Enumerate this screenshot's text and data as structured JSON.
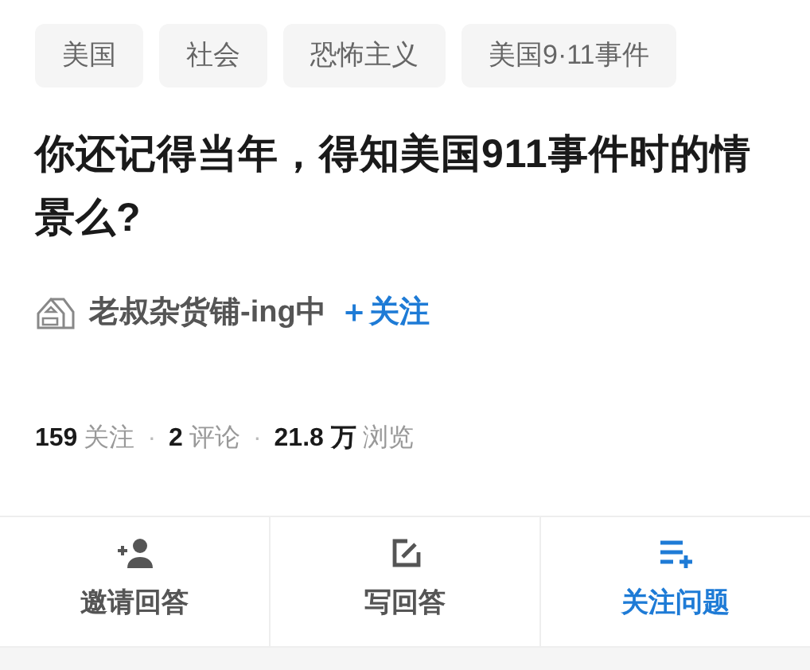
{
  "tags": [
    "美国",
    "社会",
    "恐怖主义",
    "美国9·11事件"
  ],
  "title": "你还记得当年，得知美国911事件时的情景么?",
  "author": {
    "name": "老叔杂货铺-ing中",
    "follow": "＋关注"
  },
  "stats": [
    {
      "number": "159",
      "label": "关注"
    },
    {
      "number": "2",
      "label": "评论"
    },
    {
      "number": "21.8 万",
      "label": "浏览"
    }
  ],
  "separator": "·",
  "actions": [
    {
      "kind": "invite",
      "label": "邀请回答",
      "highlighted": false
    },
    {
      "kind": "write",
      "label": "写回答",
      "highlighted": false
    },
    {
      "kind": "follow",
      "label": "关注问题",
      "highlighted": true
    }
  ]
}
